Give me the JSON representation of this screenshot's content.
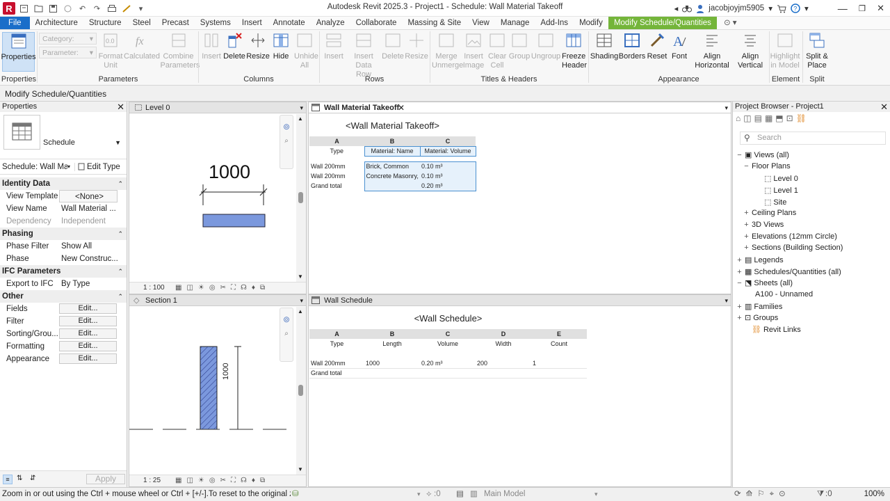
{
  "window": {
    "title": "Autodesk Revit 2025.3 - Project1 - Schedule: Wall Material Takeoff",
    "user": "jacobjoyjm5905"
  },
  "ribbon_tabs": [
    "File",
    "Architecture",
    "Structure",
    "Steel",
    "Precast",
    "Systems",
    "Insert",
    "Annotate",
    "Analyze",
    "Collaborate",
    "Massing & Site",
    "View",
    "Manage",
    "Add-Ins",
    "Modify",
    "Modify Schedule/Quantities"
  ],
  "ribbon": {
    "properties_label": "Properties",
    "category_placeholder": "Category:",
    "parameter_placeholder": "Parameter:",
    "format_unit": "Format Unit",
    "calculated": "Calculated",
    "combine_parameters": "Combine Parameters",
    "insert": "Insert",
    "delete": "Delete",
    "resize": "Resize",
    "hide": "Hide",
    "unhide_all": "Unhide All",
    "insert_rows": "Insert",
    "insert_data_row": "Insert Data Row",
    "delete_rows": "Delete",
    "resize_rows": "Resize",
    "merge_unmerge": "Merge Unmerge",
    "insert_image": "Insert Image",
    "clear_cell": "Clear Cell",
    "group": "Group",
    "ungroup": "Ungroup",
    "freeze_header": "Freeze Header",
    "shading": "Shading",
    "borders": "Borders",
    "reset": "Reset",
    "font": "Font",
    "align_horizontal": "Align Horizontal",
    "align_vertical": "Align Vertical",
    "highlight_in_model": "Highlight in Model",
    "split_place": "Split & Place",
    "groups": {
      "properties": "Properties",
      "parameters": "Parameters",
      "columns": "Columns",
      "rows": "Rows",
      "titles_headers": "Titles & Headers",
      "appearance": "Appearance",
      "element": "Element",
      "split": "Split"
    }
  },
  "options_bar": "Modify Schedule/Quantities",
  "properties_panel": {
    "title": "Properties",
    "type_name": "Schedule",
    "instance": "Schedule: Wall Ma",
    "edit_type": "Edit Type",
    "sections": {
      "identity": "Identity Data",
      "phasing": "Phasing",
      "ifc": "IFC Parameters",
      "other": "Other"
    },
    "rows": {
      "view_template": {
        "k": "View Template",
        "v": "<None>"
      },
      "view_name": {
        "k": "View Name",
        "v": "Wall Material ..."
      },
      "dependency": {
        "k": "Dependency",
        "v": "Independent"
      },
      "phase_filter": {
        "k": "Phase Filter",
        "v": "Show All"
      },
      "phase": {
        "k": "Phase",
        "v": "New Construc..."
      },
      "export_ifc": {
        "k": "Export to IFC",
        "v": "By Type"
      },
      "fields": {
        "k": "Fields",
        "v": "Edit..."
      },
      "filter": {
        "k": "Filter",
        "v": "Edit..."
      },
      "sorting": {
        "k": "Sorting/Grou...",
        "v": "Edit..."
      },
      "formatting": {
        "k": "Formatting",
        "v": "Edit..."
      },
      "appearance": {
        "k": "Appearance",
        "v": "Edit..."
      }
    },
    "apply": "Apply"
  },
  "view_level0": {
    "title": "Level 0",
    "dimension": "1000",
    "scale": "1 : 100"
  },
  "view_section1": {
    "title": "Section 1",
    "dimension": "1000",
    "scale": "1 : 25"
  },
  "material_takeoff": {
    "tab": "Wall Material Takeoff",
    "title": "<Wall Material Takeoff>",
    "col_letters": [
      "A",
      "B",
      "C"
    ],
    "headers": [
      "Type",
      "Material: Name",
      "Material: Volume"
    ],
    "rows": [
      [
        "Wall 200mm",
        "Brick, Common",
        "0.10 m³"
      ],
      [
        "Wall 200mm",
        "Concrete Masonry,",
        "0.10 m³"
      ],
      [
        "Grand total",
        "",
        "0.20 m³"
      ]
    ]
  },
  "wall_schedule": {
    "tab": "Wall Schedule",
    "title": "<Wall Schedule>",
    "col_letters": [
      "A",
      "B",
      "C",
      "D",
      "E"
    ],
    "headers": [
      "Type",
      "Length",
      "Volume",
      "Width",
      "Count"
    ],
    "rows": [
      [
        "Wall 200mm",
        "1000",
        "0.20 m³",
        "200",
        "1"
      ],
      [
        "Grand total",
        "",
        "",
        "",
        ""
      ]
    ]
  },
  "project_browser": {
    "title": "Project Browser - Project1",
    "search_placeholder": "Search",
    "nodes": {
      "views": "Views (all)",
      "floor_plans": "Floor Plans",
      "level0": "Level 0",
      "level1": "Level 1",
      "site": "Site",
      "ceiling": "Ceiling Plans",
      "views3d": "3D Views",
      "elevations": "Elevations (12mm Circle)",
      "sections": "Sections (Building Section)",
      "legends": "Legends",
      "schedules": "Schedules/Quantities (all)",
      "sheets": "Sheets (all)",
      "a100": "A100 - Unnamed",
      "families": "Families",
      "groups": "Groups",
      "links": "Revit Links"
    }
  },
  "status": {
    "text": "Zoom in or out using the Ctrl + mouse wheel or Ctrl + [+/-].To reset to the original zoom le",
    "count": ":0",
    "model": "Main Model",
    "filter_count": ":0",
    "zoom": "100%"
  },
  "colors": {
    "file_tab": "#1a6ec9",
    "context_tab": "#74b53a",
    "wall_fill": "#7b98dd"
  }
}
